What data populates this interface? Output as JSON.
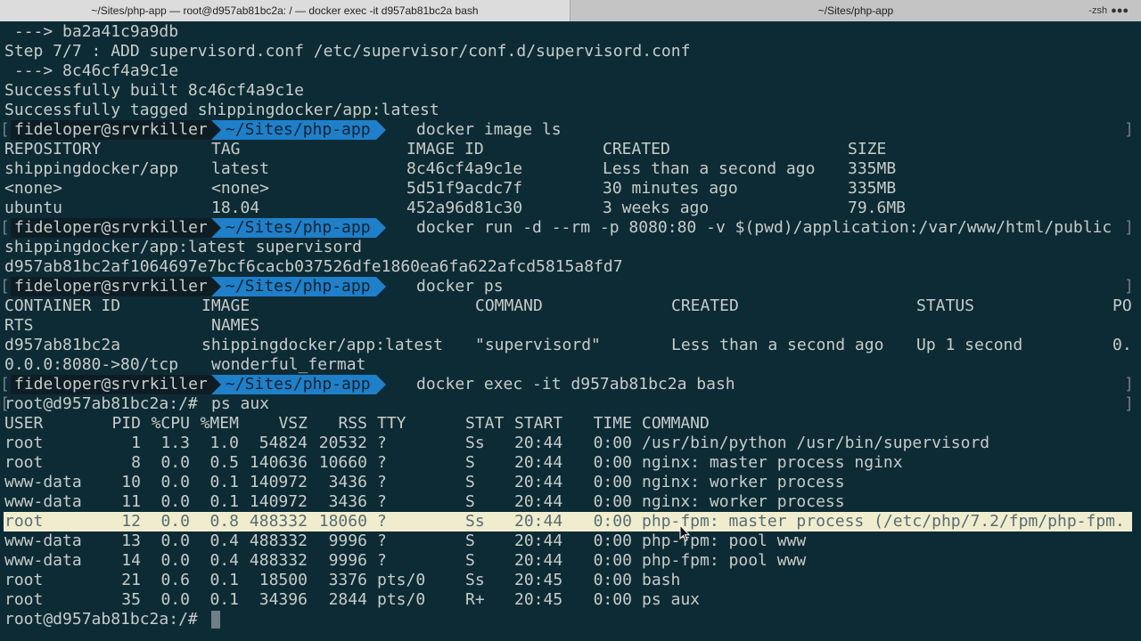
{
  "tabs": [
    {
      "label": "~/Sites/php-app — root@d957ab81bc2a: / — docker exec -it d957ab81bc2a bash",
      "active": true
    },
    {
      "label": "~/Sites/php-app",
      "active": false
    }
  ],
  "tab_side": {
    "label": "-zsh",
    "glyph": "●●●"
  },
  "colors": {
    "background": "#0d2b35",
    "prompt_path": "#1f7fc9",
    "prompt_user_bg": "#0e1d24",
    "highlight": "#f0edcf",
    "text": "#c7ccc9"
  },
  "prompt": {
    "user": "fideloper@srvrkiller",
    "path": "~/Sites/php-app"
  },
  "lines": {
    "l1": " ---> ba2a41c9a9db",
    "l2": "Step 7/7 : ADD supervisord.conf /etc/supervisor/conf.d/supervisord.conf",
    "l3": " ---> 8c46cf4a9c1e",
    "l4": "Successfully built 8c46cf4a9c1e",
    "l5": "Successfully tagged shippingdocker/app:latest",
    "run_wrap": "shippingdocker/app:latest supervisord",
    "container_hash": "d957ab81bc2af1064697e7bcf6cacb037526dfe1860ea6fa622afcd5815a8fd7"
  },
  "commands": {
    "image_ls": "docker image ls",
    "run": "docker run -d --rm -p 8080:80 -v $(pwd)/application:/var/www/html/public",
    "ps": "docker ps",
    "exec": "docker exec -it d957ab81bc2a bash"
  },
  "images_table": {
    "headers": [
      "REPOSITORY",
      "TAG",
      "IMAGE ID",
      "CREATED",
      "SIZE"
    ],
    "rows": [
      [
        "shippingdocker/app",
        "latest",
        "8c46cf4a9c1e",
        "Less than a second ago",
        "335MB"
      ],
      [
        "<none>",
        "<none>",
        "5d51f9acdc7f",
        "30 minutes ago",
        "335MB"
      ],
      [
        "ubuntu",
        "18.04",
        "452a96d81c30",
        "3 weeks ago",
        "79.6MB"
      ]
    ]
  },
  "ps_table": {
    "headers": [
      "CONTAINER ID",
      "IMAGE",
      "COMMAND",
      "CREATED",
      "STATUS",
      "PO"
    ],
    "headers_wrap": [
      "RTS",
      "NAMES"
    ],
    "row": [
      "d957ab81bc2a",
      "shippingdocker/app:latest",
      "\"supervisord\"",
      "Less than a second ago",
      "Up 1 second",
      "0."
    ],
    "row_wrap": [
      "0.0.0:8080->80/tcp",
      "wonderful_fermat"
    ]
  },
  "root_prompt": "root@d957ab81bc2a:/#",
  "root_cmd": "ps aux",
  "proc_table": {
    "headers": [
      "USER",
      "PID",
      "%CPU",
      "%MEM",
      "VSZ",
      "RSS",
      "TTY",
      "STAT",
      "START",
      "TIME",
      "COMMAND"
    ],
    "rows": [
      [
        "root",
        "1",
        "1.3",
        "1.0",
        "54824",
        "20532",
        "?",
        "Ss",
        "20:44",
        "0:00",
        "/usr/bin/python /usr/bin/supervisord"
      ],
      [
        "root",
        "8",
        "0.0",
        "0.5",
        "140636",
        "10660",
        "?",
        "S",
        "20:44",
        "0:00",
        "nginx: master process nginx"
      ],
      [
        "www-data",
        "10",
        "0.0",
        "0.1",
        "140972",
        "3436",
        "?",
        "S",
        "20:44",
        "0:00",
        "nginx: worker process"
      ],
      [
        "www-data",
        "11",
        "0.0",
        "0.1",
        "140972",
        "3436",
        "?",
        "S",
        "20:44",
        "0:00",
        "nginx: worker process"
      ],
      [
        "root",
        "12",
        "0.0",
        "0.8",
        "488332",
        "18060",
        "?",
        "Ss",
        "20:44",
        "0:00",
        "php-fpm: master process (/etc/php/7.2/fpm/php-fpm."
      ],
      [
        "www-data",
        "13",
        "0.0",
        "0.4",
        "488332",
        "9996",
        "?",
        "S",
        "20:44",
        "0:00",
        "php-fpm: pool www"
      ],
      [
        "www-data",
        "14",
        "0.0",
        "0.4",
        "488332",
        "9996",
        "?",
        "S",
        "20:44",
        "0:00",
        "php-fpm: pool www"
      ],
      [
        "root",
        "21",
        "0.6",
        "0.1",
        "18500",
        "3376",
        "pts/0",
        "Ss",
        "20:45",
        "0:00",
        "bash"
      ],
      [
        "root",
        "35",
        "0.0",
        "0.1",
        "34396",
        "2844",
        "pts/0",
        "R+",
        "20:45",
        "0:00",
        "ps aux"
      ]
    ],
    "highlighted_row": 4
  }
}
